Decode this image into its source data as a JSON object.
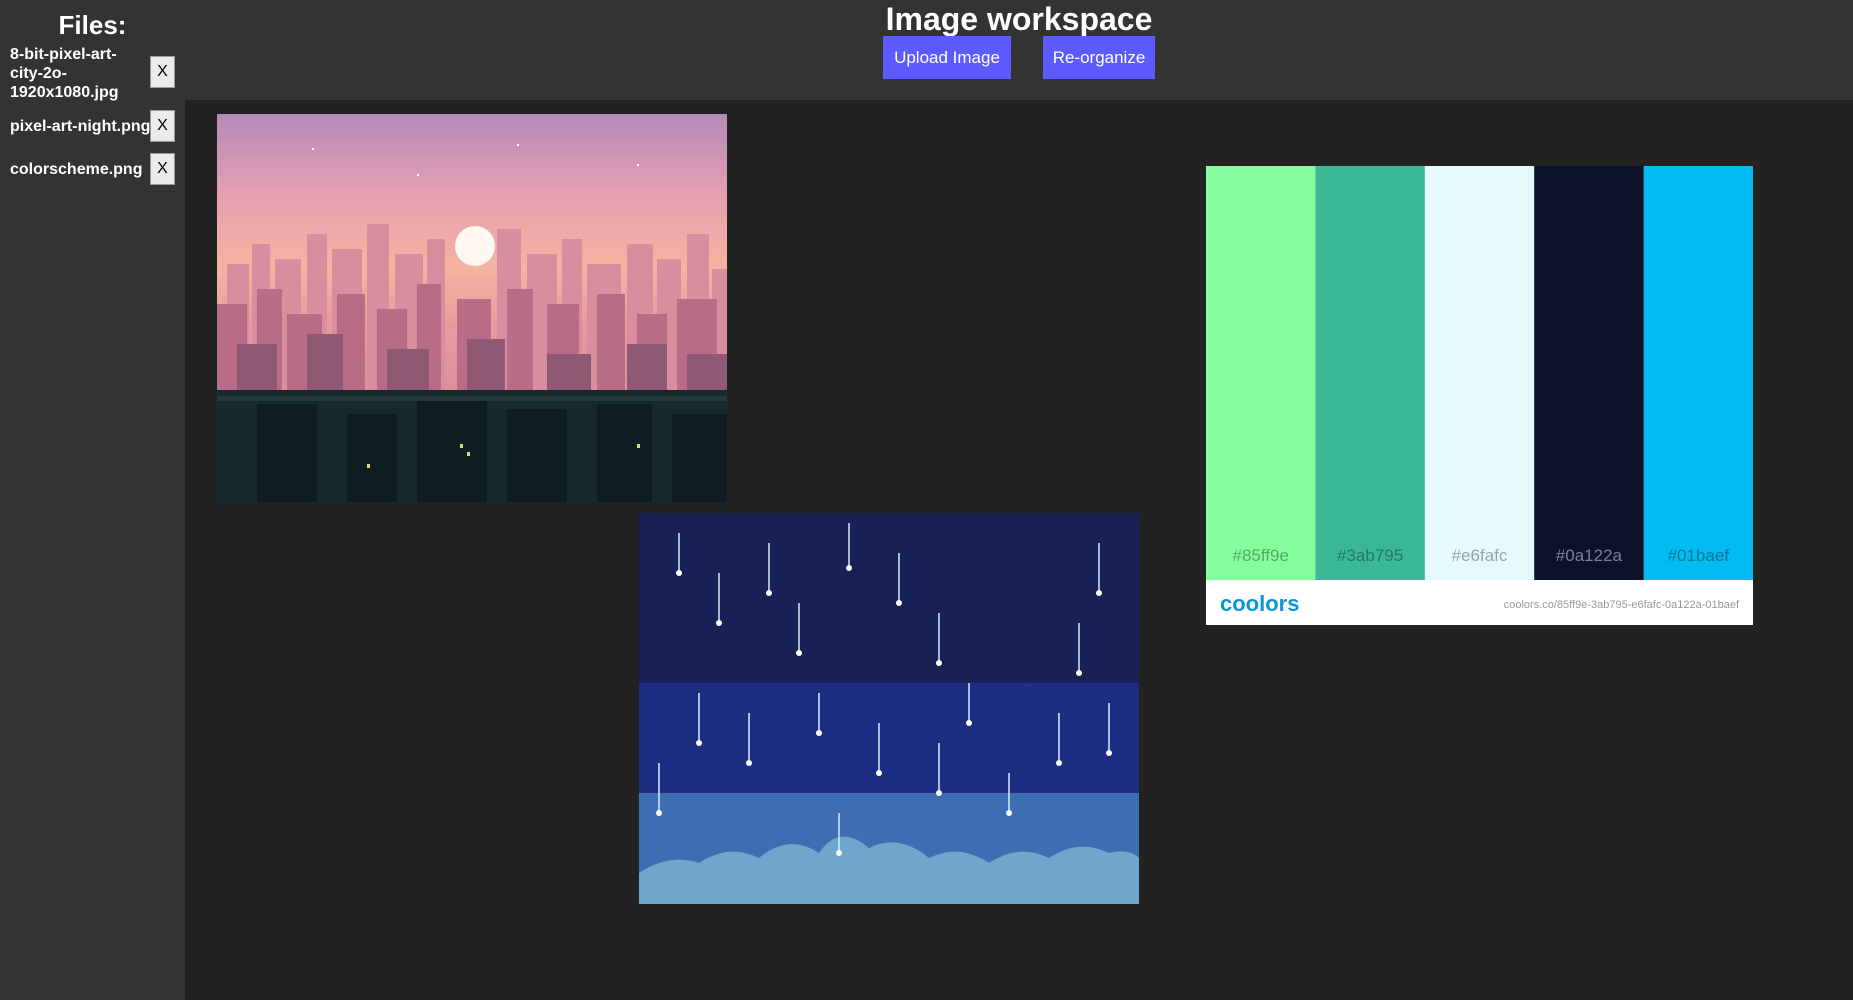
{
  "sidebar": {
    "title": "Files:",
    "files": [
      {
        "name": "8-bit-pixel-art-city-2o-1920x1080.jpg",
        "remove_label": "X"
      },
      {
        "name": "pixel-art-night.png",
        "remove_label": "X"
      },
      {
        "name": "colorscheme.png",
        "remove_label": "X"
      }
    ]
  },
  "header": {
    "title": "Image workspace",
    "upload_label": "Upload Image",
    "reorganize_label": "Re-organize"
  },
  "palette": {
    "swatches": [
      {
        "hex": "#85ff9e",
        "label": "#85ff9e"
      },
      {
        "hex": "#3ab795",
        "label": "#3ab795"
      },
      {
        "hex": "#e6fafc",
        "label": "#e6fafc"
      },
      {
        "hex": "#0a122a",
        "label": "#0a122a"
      },
      {
        "hex": "#01baef",
        "label": "#01baef"
      }
    ],
    "brand": "coolors",
    "url": "coolors.co/85ff9e-3ab795-e6fafc-0a122a-01baef"
  },
  "colors": {
    "accent_button": "#5b5bff",
    "panel": "#333333",
    "canvas": "#222222"
  }
}
